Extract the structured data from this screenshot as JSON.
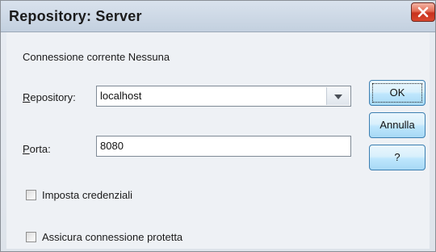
{
  "window": {
    "title": "Repository: Server"
  },
  "status": {
    "connection_text": "Connessione corrente Nessuna"
  },
  "repository": {
    "label": "Repository:",
    "value": "localhost"
  },
  "port": {
    "label": "Porta:",
    "value": "8080"
  },
  "buttons": {
    "ok": "OK",
    "cancel": "Annulla",
    "help": "?"
  },
  "checkboxes": [
    {
      "label": "Imposta credenziali",
      "checked": false
    },
    {
      "label": "Assicura connessione protetta",
      "checked": false
    }
  ],
  "icons": {
    "close": "close-icon",
    "dropdown": "chevron-down-icon"
  },
  "colors": {
    "close_button": "#d9472e",
    "button_accent": "#3c7fb1"
  }
}
